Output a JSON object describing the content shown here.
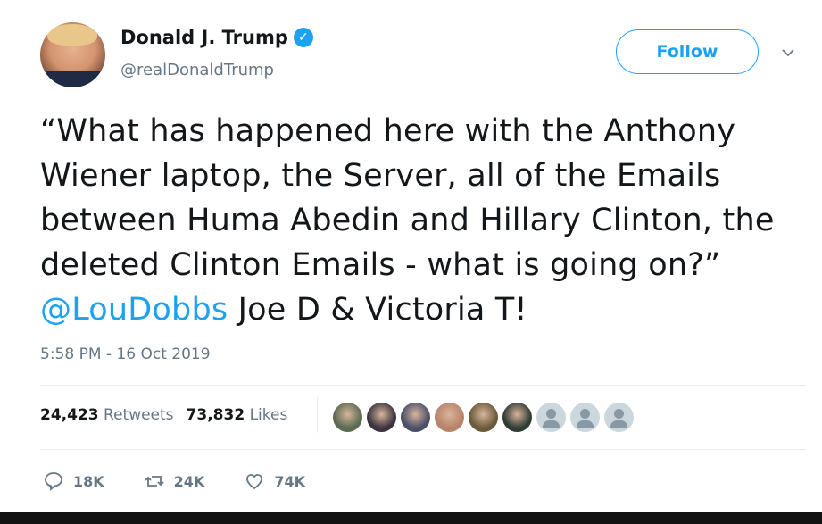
{
  "author": {
    "name": "Donald J. Trump",
    "handle": "@realDonaldTrump",
    "verified_icon": "verified-badge-icon"
  },
  "follow_label": "Follow",
  "tweet": {
    "text_before": "“What has happened here with the Anthony Wiener laptop, the Server, all of the Emails between Huma Abedin and Hillary Clinton, the deleted Clinton Emails - what is going on?” ",
    "mention": "@LouDobbs",
    "text_after": "  Joe D & Victoria T!"
  },
  "timestamp": "5:58 PM - 16 Oct 2019",
  "stats": {
    "retweets_count": "24,423",
    "retweets_label": "Retweets",
    "likes_count": "73,832",
    "likes_label": "Likes"
  },
  "likers": [
    {
      "color": "#5a6b52"
    },
    {
      "color": "#3b3440"
    },
    {
      "color": "#4a4f6a"
    },
    {
      "color": "#b8836a"
    },
    {
      "color": "#6a5a3a"
    },
    {
      "color": "#2f3b35"
    },
    {
      "color": "default"
    },
    {
      "color": "default"
    },
    {
      "color": "default"
    }
  ],
  "actions": {
    "reply": "18K",
    "retweet": "24K",
    "like": "74K"
  },
  "colors": {
    "accent": "#1da1f2",
    "secondary_text": "#657786"
  }
}
